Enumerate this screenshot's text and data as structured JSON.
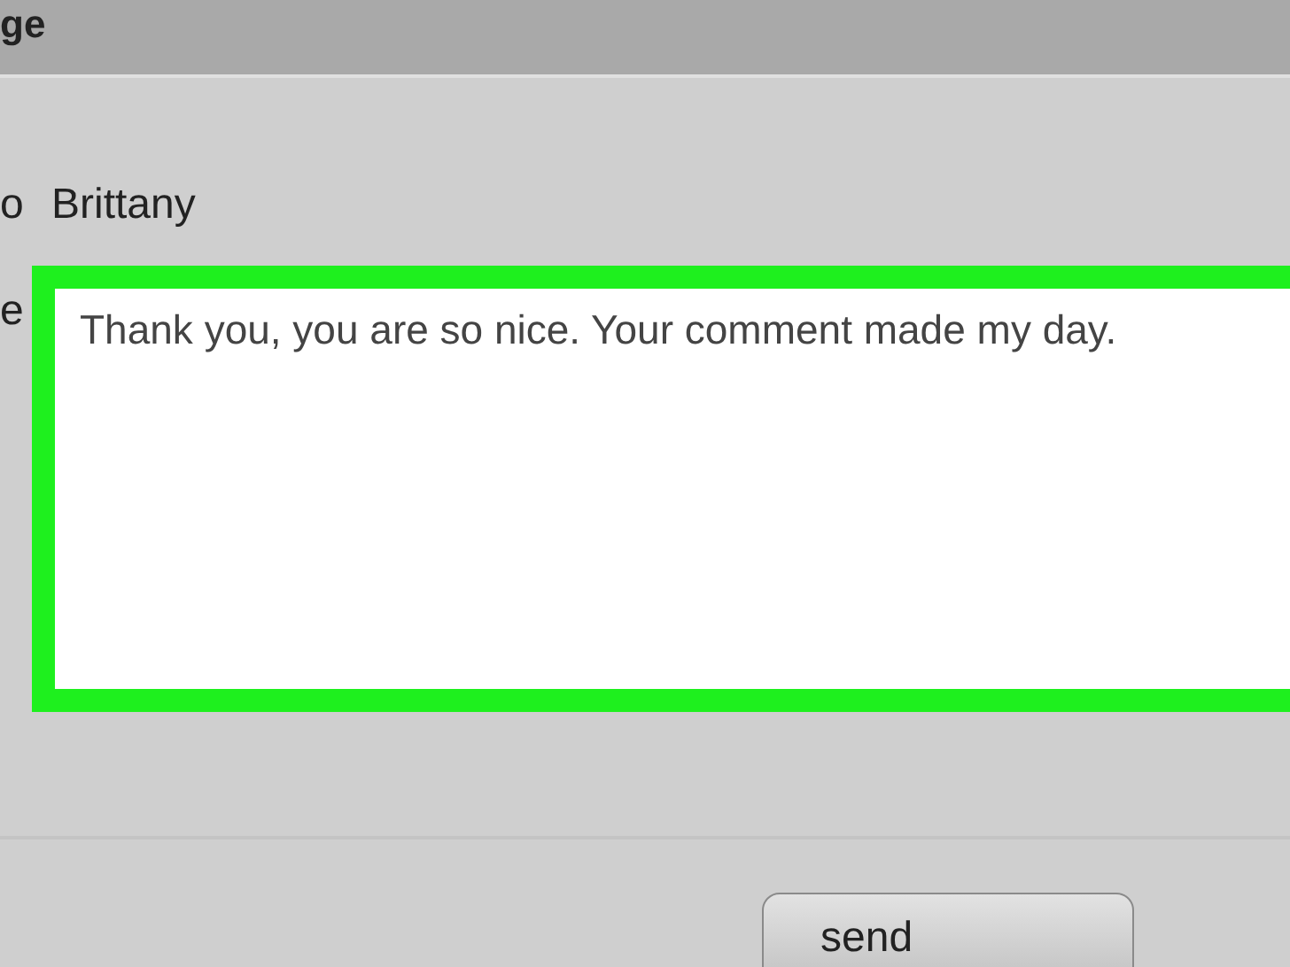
{
  "window": {
    "title": "ge"
  },
  "to": {
    "label": "o",
    "value": "Brittany"
  },
  "message": {
    "label": "e",
    "value": "Thank you, you are so nice. Your comment made my day.",
    "highlighted": true
  },
  "buttons": [
    {
      "label": "send"
    }
  ]
}
